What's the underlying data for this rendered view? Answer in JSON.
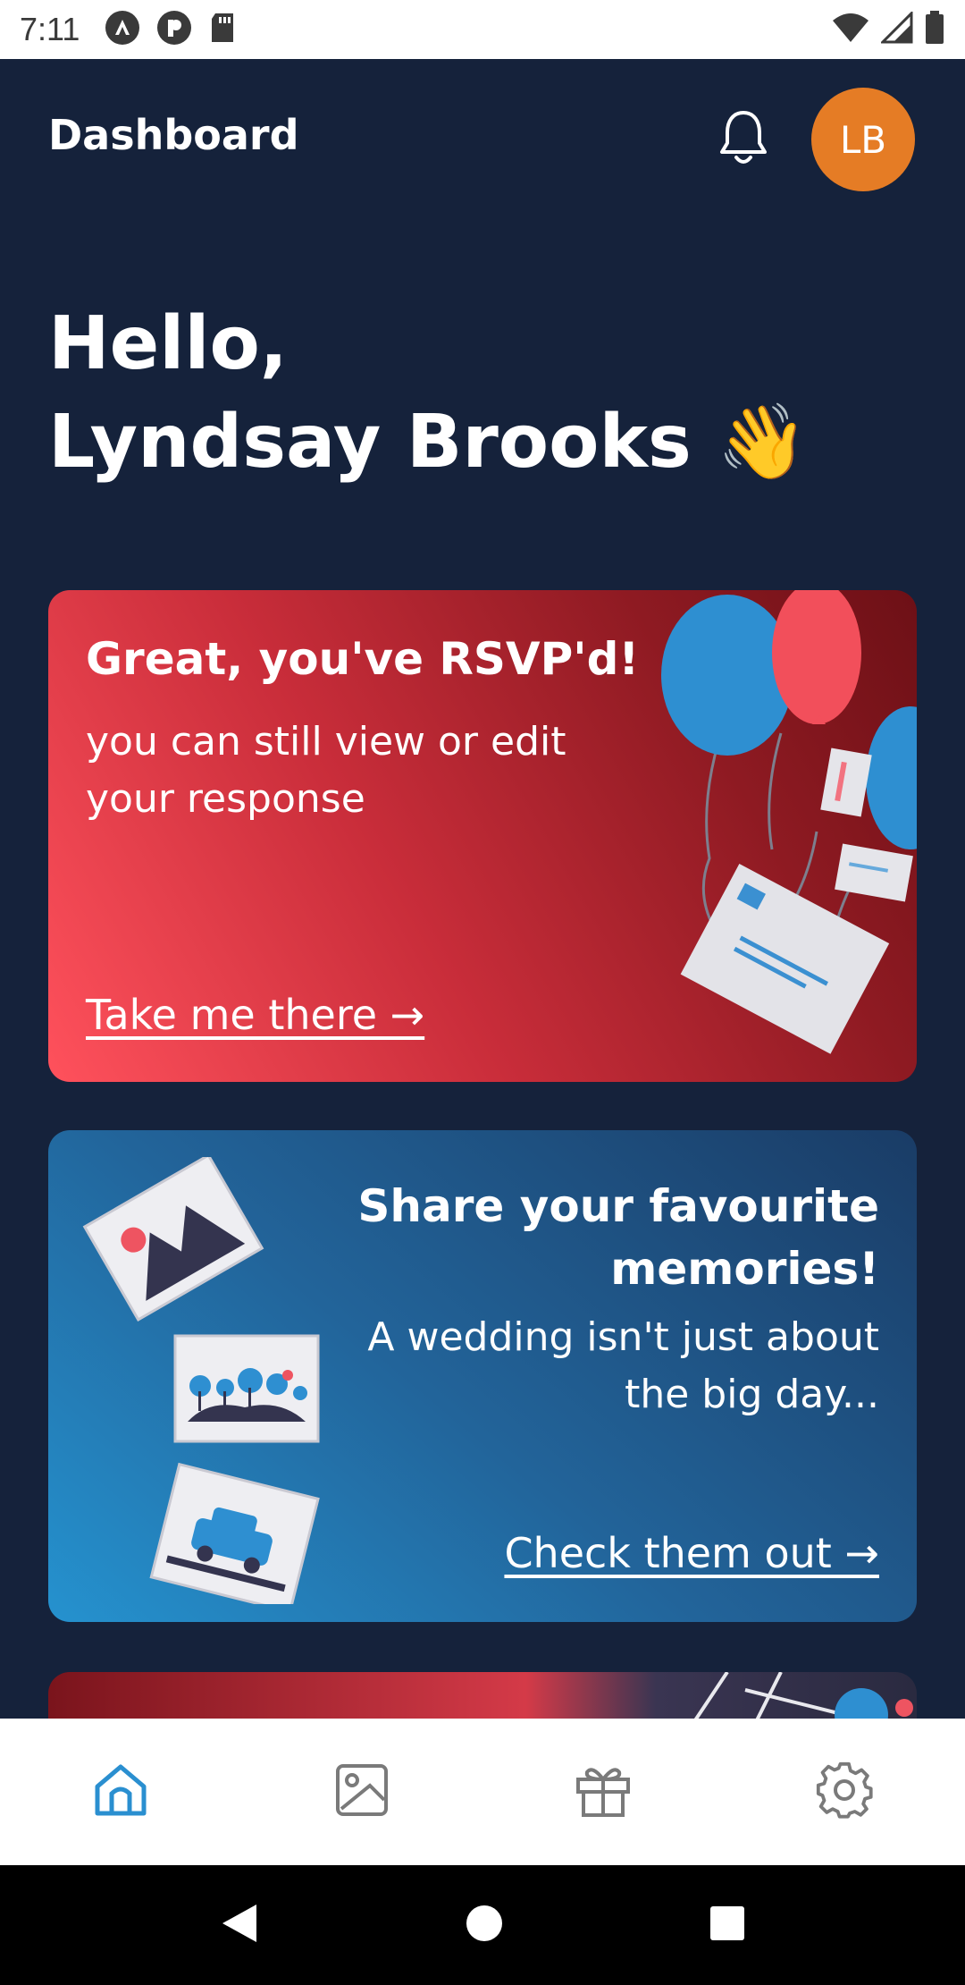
{
  "status_bar": {
    "time": "7:11"
  },
  "header": {
    "title": "Dashboard",
    "avatar_initials": "LB"
  },
  "greeting": {
    "line1": "Hello,",
    "line2": "Lyndsay Brooks",
    "emoji": "👋"
  },
  "cards": {
    "rsvp": {
      "title": "Great, you've RSVP'd!",
      "subtitle": "you can still view or edit your response",
      "link": "Take me there →"
    },
    "memories": {
      "title": "Share your favourite memories!",
      "subtitle": "A wedding isn't just about the big day...",
      "link": "Check them out →"
    }
  },
  "bottom_nav": {
    "items": [
      {
        "icon": "home-icon",
        "active": true
      },
      {
        "icon": "image-icon",
        "active": false
      },
      {
        "icon": "gift-icon",
        "active": false
      },
      {
        "icon": "settings-icon",
        "active": false
      }
    ]
  },
  "colors": {
    "background": "#15223b",
    "avatar": "#e57c25",
    "accent_active": "#2a8fd0",
    "nav_inactive": "#7a7a7a"
  }
}
